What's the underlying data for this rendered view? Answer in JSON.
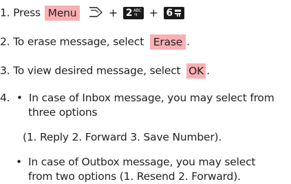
{
  "steps": {
    "s1": {
      "prefix": "1. Press",
      "menu_label": "Menu",
      "plus1": "+",
      "plus2": "+"
    },
    "s2": {
      "text": "2. To erase message, select",
      "erase_label": "Erase",
      "end": "."
    },
    "s3": {
      "text": "3. To view desired message, select",
      "ok_label": "OK",
      "end": "."
    },
    "s4": {
      "num": "4.",
      "bullet_char": "•",
      "inbox_line1": "In case of Inbox message, you may select from",
      "inbox_line2": "three options",
      "inbox_options": "(1. Reply 2. Forward 3. Save Number).",
      "outbox_line1": "In case of Outbox message, you may select",
      "outbox_line2": "from two options  (1. Resend 2. Forward)."
    }
  },
  "keys": {
    "k2": {
      "digit": "2",
      "letters": "ABC"
    },
    "k6": {
      "digit": "6"
    }
  },
  "icons": {
    "softkey": "left-softkey-icon"
  }
}
